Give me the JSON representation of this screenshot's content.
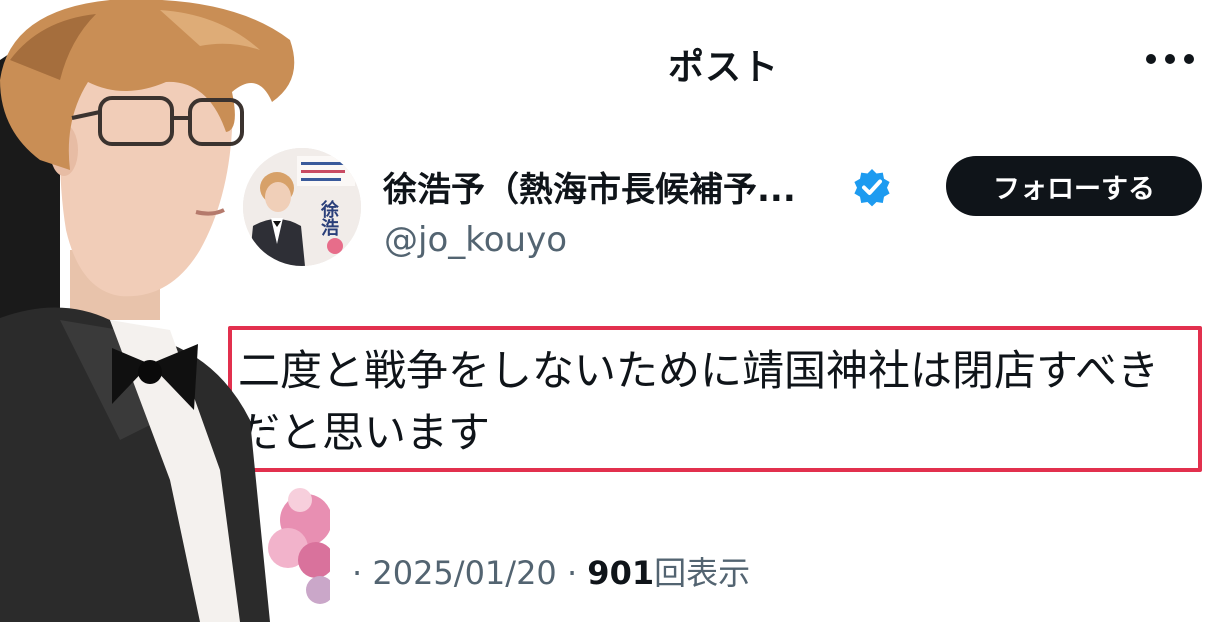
{
  "header": {
    "title": "ポスト"
  },
  "author": {
    "name": "徐浩予（熱海市長候補予...",
    "handle": "@jo_kouyo",
    "verified": true,
    "avatar_text": "徐浩"
  },
  "follow_button_label": "フォローする",
  "post": {
    "line1": "二度と戦争をしないために靖国神社は閉店すべき",
    "line2": "だと思います"
  },
  "meta": {
    "prefix": "·",
    "date": "2025/01/20",
    "separator": "·",
    "views": "901",
    "views_label": "回表示"
  },
  "colors": {
    "highlight": "#e2304e",
    "verified": "#1d9bf0",
    "button_bg": "#0f1419",
    "secondary_text": "#536471"
  }
}
